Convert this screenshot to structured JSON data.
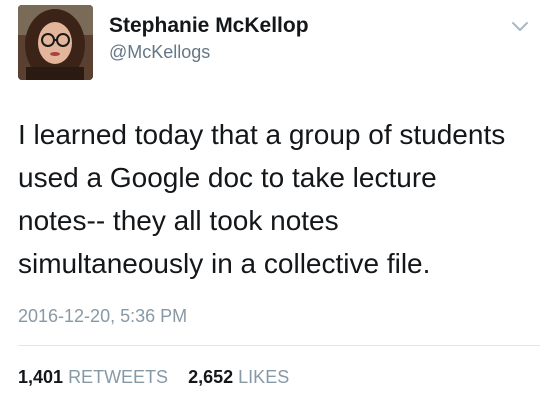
{
  "author": {
    "display_name": "Stephanie McKellop",
    "handle": "@McKellogs",
    "avatar_icon": "profile-photo"
  },
  "menu_icon": "chevron-down-icon",
  "tweet": {
    "lines": [
      "I learned today that a group of students",
      "used a Google doc to take lecture",
      "notes-- they all took notes",
      "simultaneously in a collective file."
    ],
    "timestamp": "2016-12-20, 5:36 PM"
  },
  "stats": {
    "retweets_count": "1,401",
    "retweets_label": "RETWEETS",
    "likes_count": "2,652",
    "likes_label": "LIKES"
  },
  "colors": {
    "text": "#14171a",
    "secondary": "#657786",
    "muted": "#8899a6",
    "divider": "#e1e8ed"
  }
}
